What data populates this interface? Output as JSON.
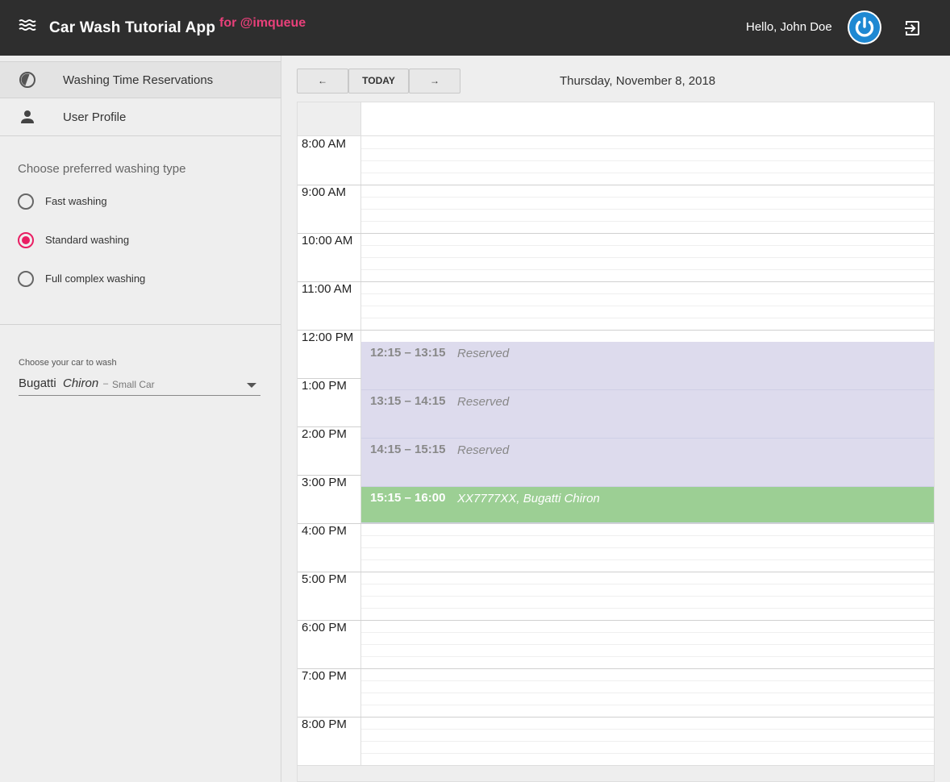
{
  "header": {
    "app_title": "Car Wash Tutorial App",
    "app_subtitle": "for @imqueue",
    "greeting": "Hello, John Doe",
    "menu_icon": "waves-menu-icon",
    "avatar_icon": "power-avatar-icon",
    "logout_icon": "logout-icon"
  },
  "sidebar": {
    "items": [
      {
        "label": "Washing Time Reservations",
        "icon": "clock-icon"
      },
      {
        "label": "User Profile",
        "icon": "person-icon"
      }
    ],
    "wash_type_title": "Choose preferred washing type",
    "wash_types": [
      {
        "label": "Fast washing",
        "checked": false
      },
      {
        "label": "Standard washing",
        "checked": true
      },
      {
        "label": "Full complex washing",
        "checked": false
      }
    ],
    "car_label": "Choose your car to wash",
    "car": {
      "make": "Bugatti",
      "model": "Chiron",
      "separator": "–",
      "size": "Small Car"
    }
  },
  "toolbar": {
    "prev": "←",
    "today": "TODAY",
    "next": "→",
    "date": "Thursday, November 8, 2018"
  },
  "calendar": {
    "hours": [
      "8:00 AM",
      "9:00 AM",
      "10:00 AM",
      "11:00 AM",
      "12:00 PM",
      "1:00 PM",
      "2:00 PM",
      "3:00 PM",
      "4:00 PM",
      "5:00 PM",
      "6:00 PM",
      "7:00 PM",
      "8:00 PM"
    ],
    "events": [
      {
        "time": "12:15 – 13:15",
        "text": "Reserved",
        "start_hour": 12.25,
        "end_hour": 13.25,
        "mine": false
      },
      {
        "time": "13:15 – 14:15",
        "text": "Reserved",
        "start_hour": 13.25,
        "end_hour": 14.25,
        "mine": false
      },
      {
        "time": "14:15 – 15:15",
        "text": "Reserved",
        "start_hour": 14.25,
        "end_hour": 15.25,
        "mine": false
      },
      {
        "time": "15:15 – 16:00",
        "text": "XX7777XX, Bugatti Chiron",
        "start_hour": 15.25,
        "end_hour": 16.0,
        "mine": true
      }
    ]
  },
  "colors": {
    "accent": "#e91e63",
    "reserved": "#dddbed",
    "mine": "#9ccf94",
    "avatar": "#1e88d2"
  }
}
